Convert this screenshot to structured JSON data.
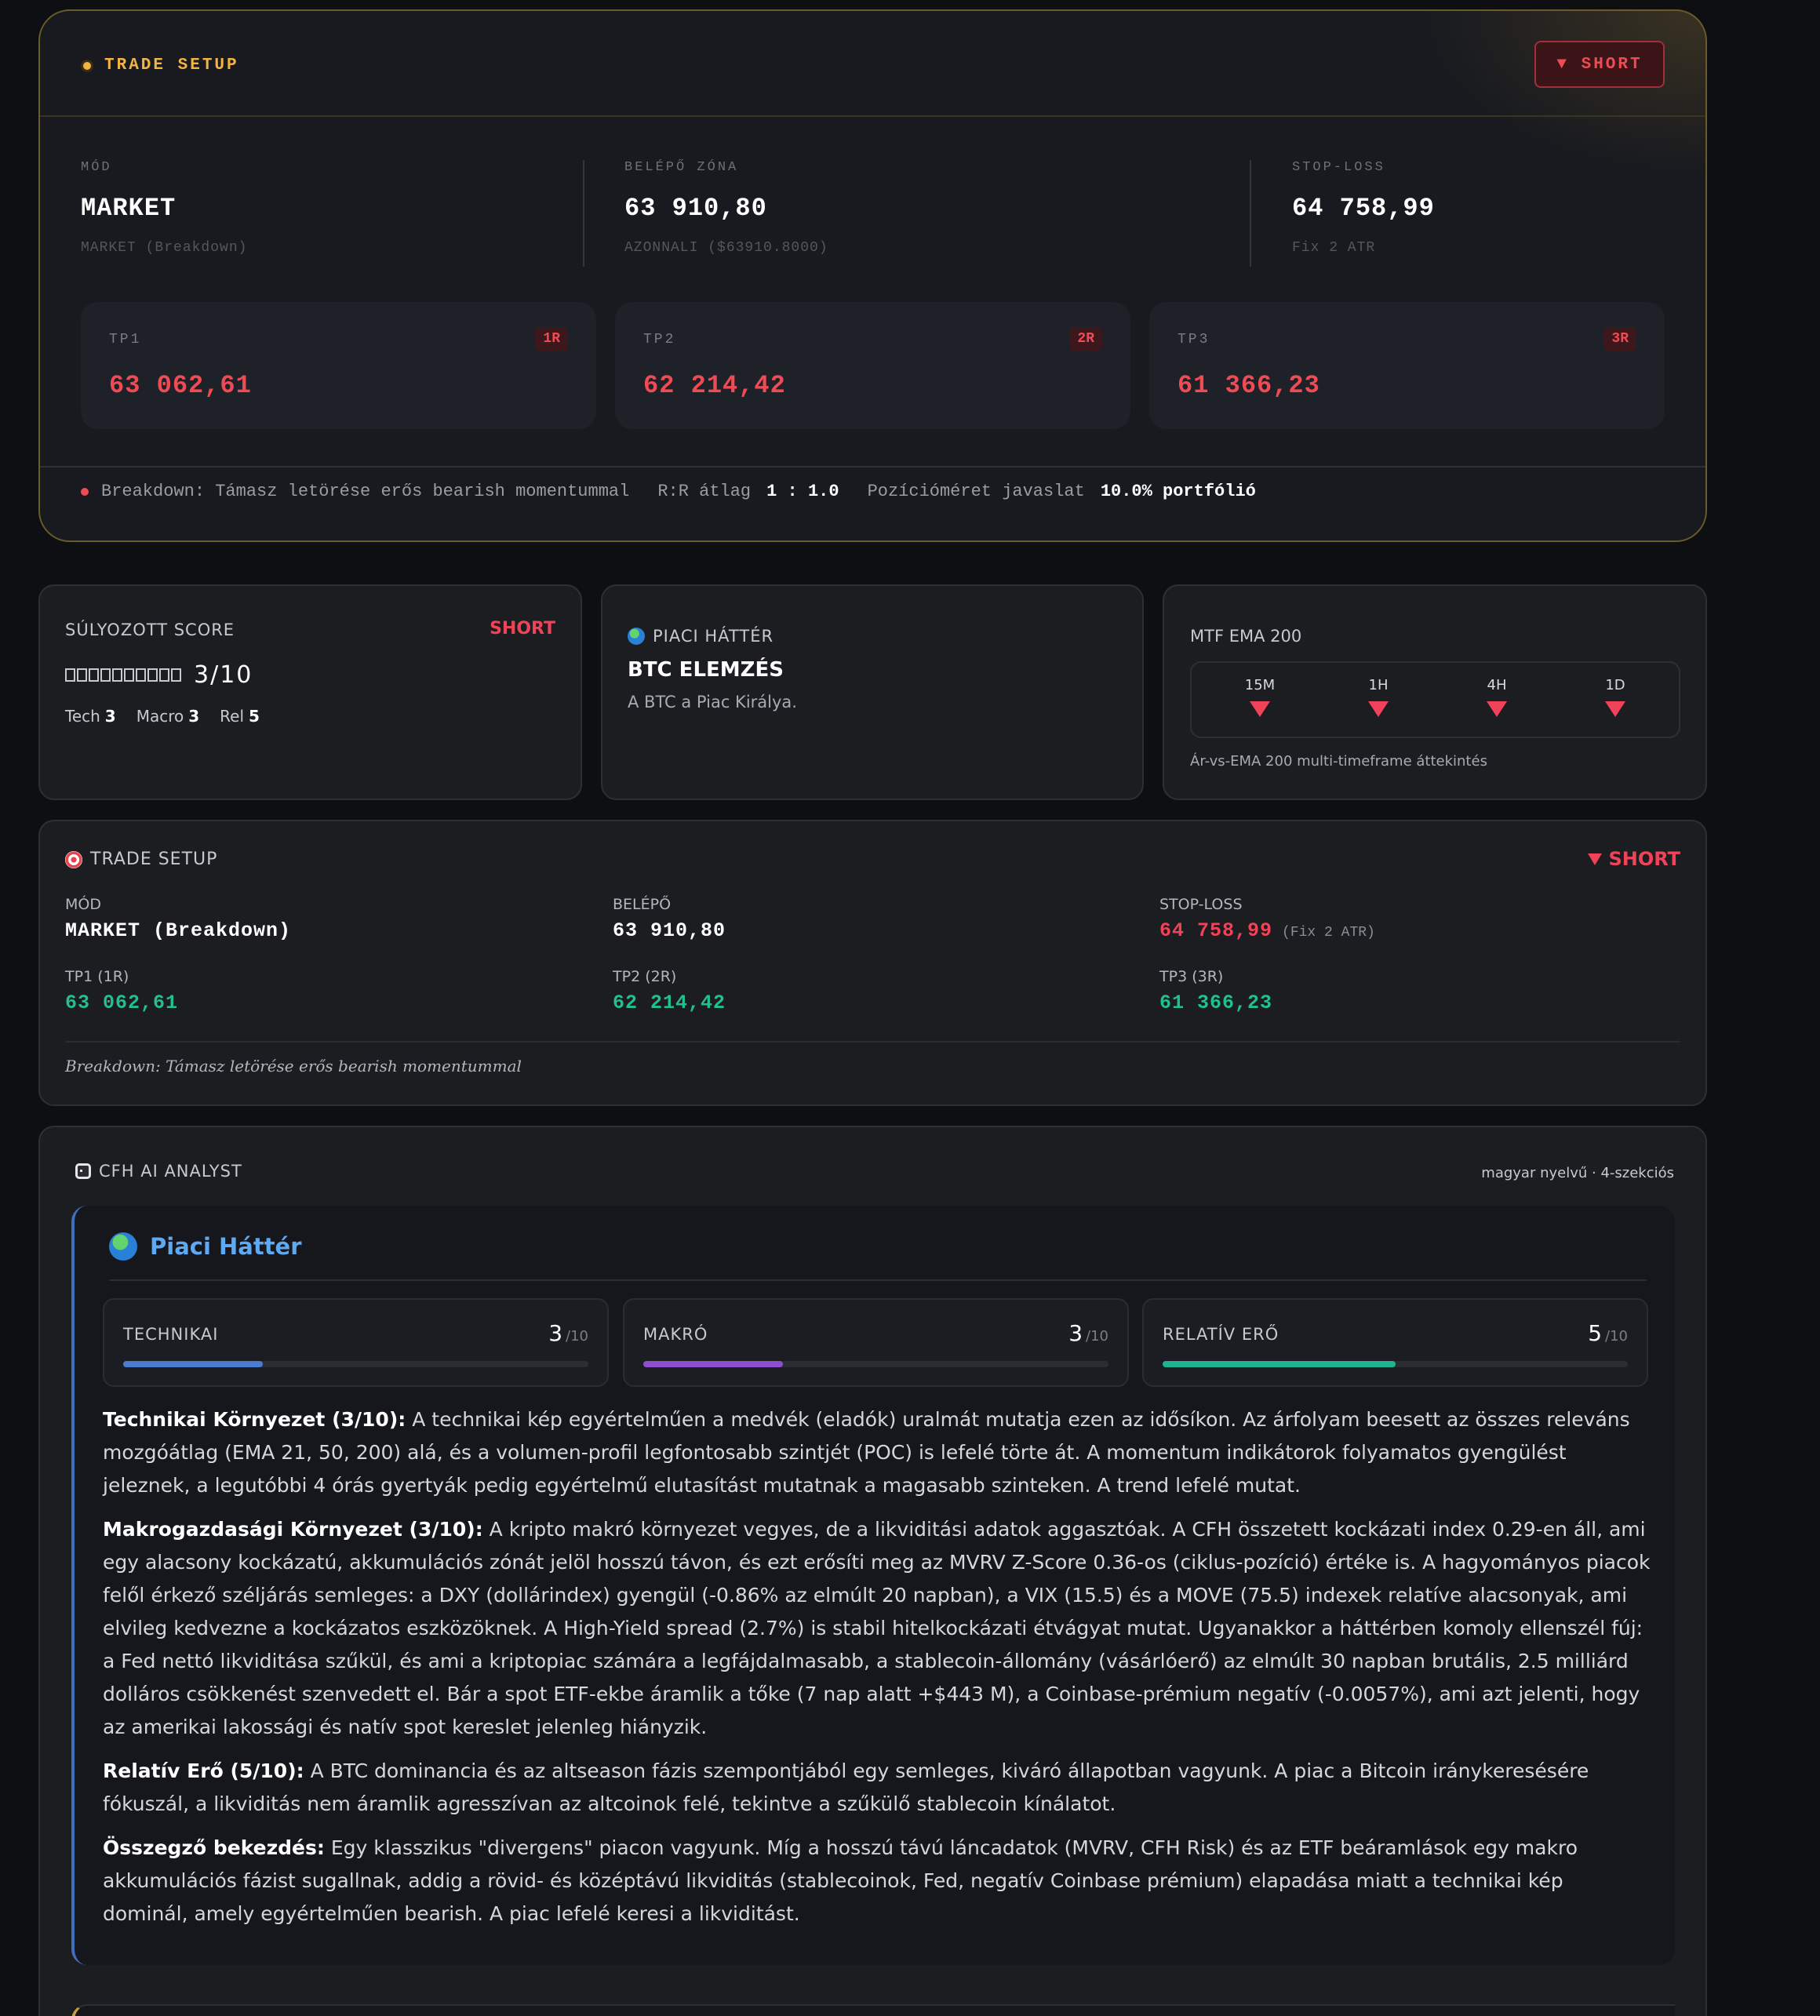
{
  "trade_setup_terminal": {
    "title": "TRADE SETUP",
    "badge": "▼ SHORT",
    "mode": {
      "label": "MÓD",
      "value": "MARKET",
      "sub": "MARKET (Breakdown)"
    },
    "entry": {
      "label": "BELÉPŐ ZÓNA",
      "value": "63 910,80",
      "sub": "AZONNALI ($63910.8000)"
    },
    "stop": {
      "label": "STOP-LOSS",
      "value": "64 758,99",
      "sub": "Fix 2 ATR"
    },
    "tps": [
      {
        "label": "TP1",
        "r": "1R",
        "value": "63 062,61"
      },
      {
        "label": "TP2",
        "r": "2R",
        "value": "62 214,42"
      },
      {
        "label": "TP3",
        "r": "3R",
        "value": "61 366,23"
      }
    ],
    "footer": {
      "reason": "Breakdown: Támasz letörése erős bearish momentummal",
      "rr_label": "R:R átlag",
      "rr_value": "1 : 1.0",
      "size_label": "Pozícióméret javaslat",
      "size_value": "10.0% portfólió"
    }
  },
  "score_card": {
    "title": "SÚLYOZOTT SCORE",
    "direction": "SHORT",
    "score": "3/10",
    "filled": 3,
    "total": 10,
    "tech_label": "Tech",
    "tech": "3",
    "macro_label": "Macro",
    "macro": "3",
    "rel_label": "Rel",
    "rel": "5"
  },
  "market_card": {
    "title": "PIACI HÁTTÉR",
    "heading": "BTC ELEMZÉS",
    "text": "A BTC a Piac Királya."
  },
  "mtf_card": {
    "title": "MTF EMA 200",
    "timeframes": [
      "15M",
      "1H",
      "4H",
      "1D"
    ],
    "note": "Ár-vs-EMA 200 multi-timeframe áttekintés"
  },
  "trade_setup_compact": {
    "title": "TRADE SETUP",
    "direction": "SHORT",
    "mode_label": "MÓD",
    "mode": "MARKET (Breakdown)",
    "entry_label": "BELÉPŐ",
    "entry": "63 910,80",
    "stop_label": "STOP-LOSS",
    "stop": "64 758,99",
    "stop_note": "(Fix 2 ATR)",
    "tp1_label": "TP1 (1R)",
    "tp1": "63 062,61",
    "tp2_label": "TP2 (2R)",
    "tp2": "62 214,42",
    "tp3_label": "TP3 (3R)",
    "tp3": "61 366,23",
    "footer": "Breakdown: Támasz letörése erős bearish momentummal"
  },
  "analyst": {
    "title": "CFH AI ANALYST",
    "meta": "magyar nyelvű · 4-szekciós",
    "section_title": "Piaci Háttér",
    "metrics": [
      {
        "label": "TECHNIKAI",
        "value": "3",
        "max": "/10",
        "fraction": 0.3,
        "color": "#4a7bd0"
      },
      {
        "label": "MAKRÓ",
        "value": "3",
        "max": "/10",
        "fraction": 0.3,
        "color": "#8e4ed0"
      },
      {
        "label": "RELATÍV ERŐ",
        "value": "5",
        "max": "/10",
        "fraction": 0.5,
        "color": "#1fb392"
      }
    ],
    "paragraphs": [
      {
        "head": "Technikai Környezet (3/10):",
        "body": " A technikai kép egyértelműen a medvék (eladók) uralmát mutatja ezen az idősíkon. Az árfolyam beesett az összes releváns mozgóátlag (EMA 21, 50, 200) alá, és a volumen-profil legfontosabb szintjét (POC) is lefelé törte át. A momentum indikátorok folyamatos gyengülést jeleznek, a legutóbbi 4 órás gyertyák pedig egyértelmű elutasítást mutatnak a magasabb szinteken. A trend lefelé mutat."
      },
      {
        "head": "Makrogazdasági Környezet (3/10):",
        "body": " A kripto makró környezet vegyes, de a likviditási adatok aggasztóak. A CFH összetett kockázati index 0.29-en áll, ami egy alacsony kockázatú, akkumulációs zónát jelöl hosszú távon, és ezt erősíti meg az MVRV Z-Score 0.36-os (ciklus-pozíció) értéke is. A hagyományos piacok felől érkező széljárás semleges: a DXY (dollárindex) gyengül (-0.86% az elmúlt 20 napban), a VIX (15.5) és a MOVE (75.5) indexek relatíve alacsonyak, ami elvileg kedvezne a kockázatos eszközöknek. A High-Yield spread (2.7%) is stabil hitelkockázati étvágyat mutat. Ugyanakkor a háttérben komoly ellenszél fúj: a Fed nettó likviditása szűkül, és ami a kriptopiac számára a legfájdalmasabb, a stablecoin-állomány (vásárlóerő) az elmúlt 30 napban brutális, 2.5 milliárd dolláros csökkenést szenvedett el. Bár a spot ETF-ekbe áramlik a tőke (7 nap alatt +$443 M), a Coinbase-prémium negatív (-0.0057%), ami azt jelenti, hogy az amerikai lakossági és natív spot kereslet jelenleg hiányzik."
      },
      {
        "head": "Relatív Erő (5/10):",
        "body": " A BTC dominancia és az altseason fázis szempontjából egy semleges, kiváró állapotban vagyunk. A piac a Bitcoin iránykeresésére fókuszál, a likviditás nem áramlik agresszívan az altcoinok felé, tekintve a szűkülő stablecoin kínálatot."
      },
      {
        "head": "Összegző bekezdés:",
        "body": " Egy klasszikus \"divergens\" piacon vagyunk. Míg a hosszú távú láncadatok (MVRV, CFH Risk) és az ETF beáramlások egy makro akkumulációs fázist sugallnak, addig a rövid- és középtávú likviditás (stablecoinok, Fed, negatív Coinbase prémium) elapadása miatt a technikai kép dominál, amely egyértelműen bearish. A piac lefelé keresi a likviditást."
      }
    ]
  }
}
